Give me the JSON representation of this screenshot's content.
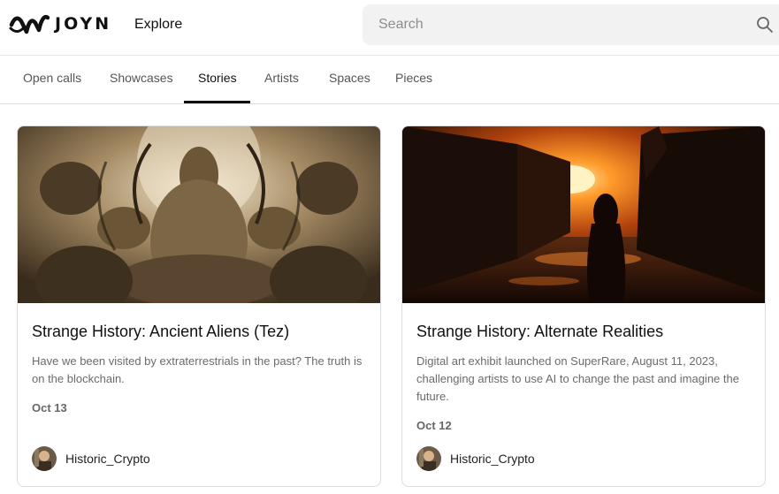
{
  "header": {
    "brand": "JOYN",
    "nav_label": "Explore",
    "search_placeholder": "Search"
  },
  "tabs": [
    {
      "label": "Open calls",
      "active": false
    },
    {
      "label": "Showcases",
      "active": false
    },
    {
      "label": "Stories",
      "active": true
    },
    {
      "label": "Artists",
      "active": false
    },
    {
      "label": "Spaces",
      "active": false
    },
    {
      "label": "Pieces",
      "active": false
    }
  ],
  "cards": [
    {
      "title": "Strange History: Ancient Aliens (Tez)",
      "description": "Have we been visited by extraterrestrials in the past? The truth is on the blockchain.",
      "date": "Oct 13",
      "author": "Historic_Crypto"
    },
    {
      "title": "Strange History: Alternate Realities",
      "description": "Digital art exhibit launched on SuperRare, August 11, 2023, challenging artists to use AI to change the past and imagine the future.",
      "date": "Oct 12",
      "author": "Historic_Crypto"
    }
  ],
  "icons": {
    "logo": "joyn-logo-icon",
    "search": "search-icon",
    "avatar": "avatar"
  },
  "colors": {
    "accent": "#111111",
    "search_bg": "#f2f2f2",
    "muted_text": "#6b6b6b"
  }
}
